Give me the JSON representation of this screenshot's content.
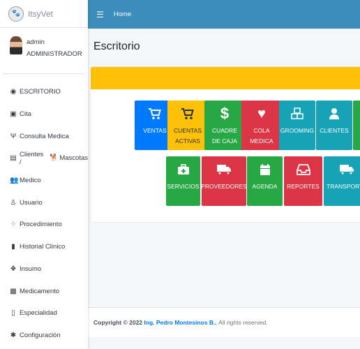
{
  "brand": {
    "name": "ItsyVet"
  },
  "user": {
    "name": "admin",
    "role": "ADMINISTRADOR"
  },
  "sidebar": {
    "items": [
      {
        "label": "ESCRITORIO",
        "icon": "dashboard-icon"
      },
      {
        "label": "Cita",
        "icon": "calendar-icon"
      },
      {
        "label": "Consulta Medica",
        "icon": "stethoscope-icon"
      },
      {
        "label": "Clientes /",
        "label2": "Mascotas",
        "icon": "id-card-icon"
      },
      {
        "label": "Medico",
        "icon": "users-icon"
      },
      {
        "label": "Usuario",
        "icon": "user-icon"
      },
      {
        "label": "Procedimiento",
        "icon": "spinner-icon"
      },
      {
        "label": "Historial Clinico",
        "icon": "file-medical-icon"
      },
      {
        "label": "Insumo",
        "icon": "cubes-icon"
      },
      {
        "label": "Medicamento",
        "icon": "medkit-icon"
      },
      {
        "label": "Especialidad",
        "icon": "book-medical-icon"
      },
      {
        "label": "Configuración",
        "icon": "cog-icon"
      }
    ]
  },
  "header": {
    "home_label": "Home"
  },
  "main": {
    "title": "Escritorio"
  },
  "tiles": [
    {
      "line1": "VENTAS",
      "line2": "",
      "color": "#007bff",
      "icon": "cart-icon"
    },
    {
      "line1": "CUENTAS",
      "line2": "ACTIVAS",
      "color": "#ffc107",
      "icon": "cart-icon"
    },
    {
      "line1": "CUADRE",
      "line2": "DE CAJA",
      "color": "#28a745",
      "icon": "dollar-icon"
    },
    {
      "line1": "COLA",
      "line2": "MEDICA",
      "color": "#dc3545",
      "icon": "heart-icon"
    },
    {
      "line1": "GROOMING",
      "line2": "",
      "color": "#17a2b8",
      "icon": "cubes-icon"
    },
    {
      "line1": "CLIENTES",
      "line2": "",
      "color": "#17a2b8",
      "icon": "user-icon"
    },
    {
      "line1": "",
      "line2": "",
      "color": "#28a745",
      "icon": ""
    },
    {
      "line1": "SERVICIOS",
      "line2": "",
      "color": "#28a745",
      "icon": "briefcase-medical-icon"
    },
    {
      "line1": "PROVEEDORES",
      "line2": "",
      "color": "#dc3545",
      "icon": "truck-icon"
    },
    {
      "line1": "AGENDA",
      "line2": "",
      "color": "#28a745",
      "icon": "calendar-icon"
    },
    {
      "line1": "REPORTES",
      "line2": "",
      "color": "#dc3545",
      "icon": "inbox-icon"
    },
    {
      "line1": "TRANSPORTE",
      "line2": "",
      "color": "#17a2b8",
      "icon": "truck-icon"
    }
  ],
  "footer": {
    "copyright": "Copyright © 2022",
    "author": "Ing. Pedro Montesinos B..",
    "rights": "All rights reserved."
  }
}
